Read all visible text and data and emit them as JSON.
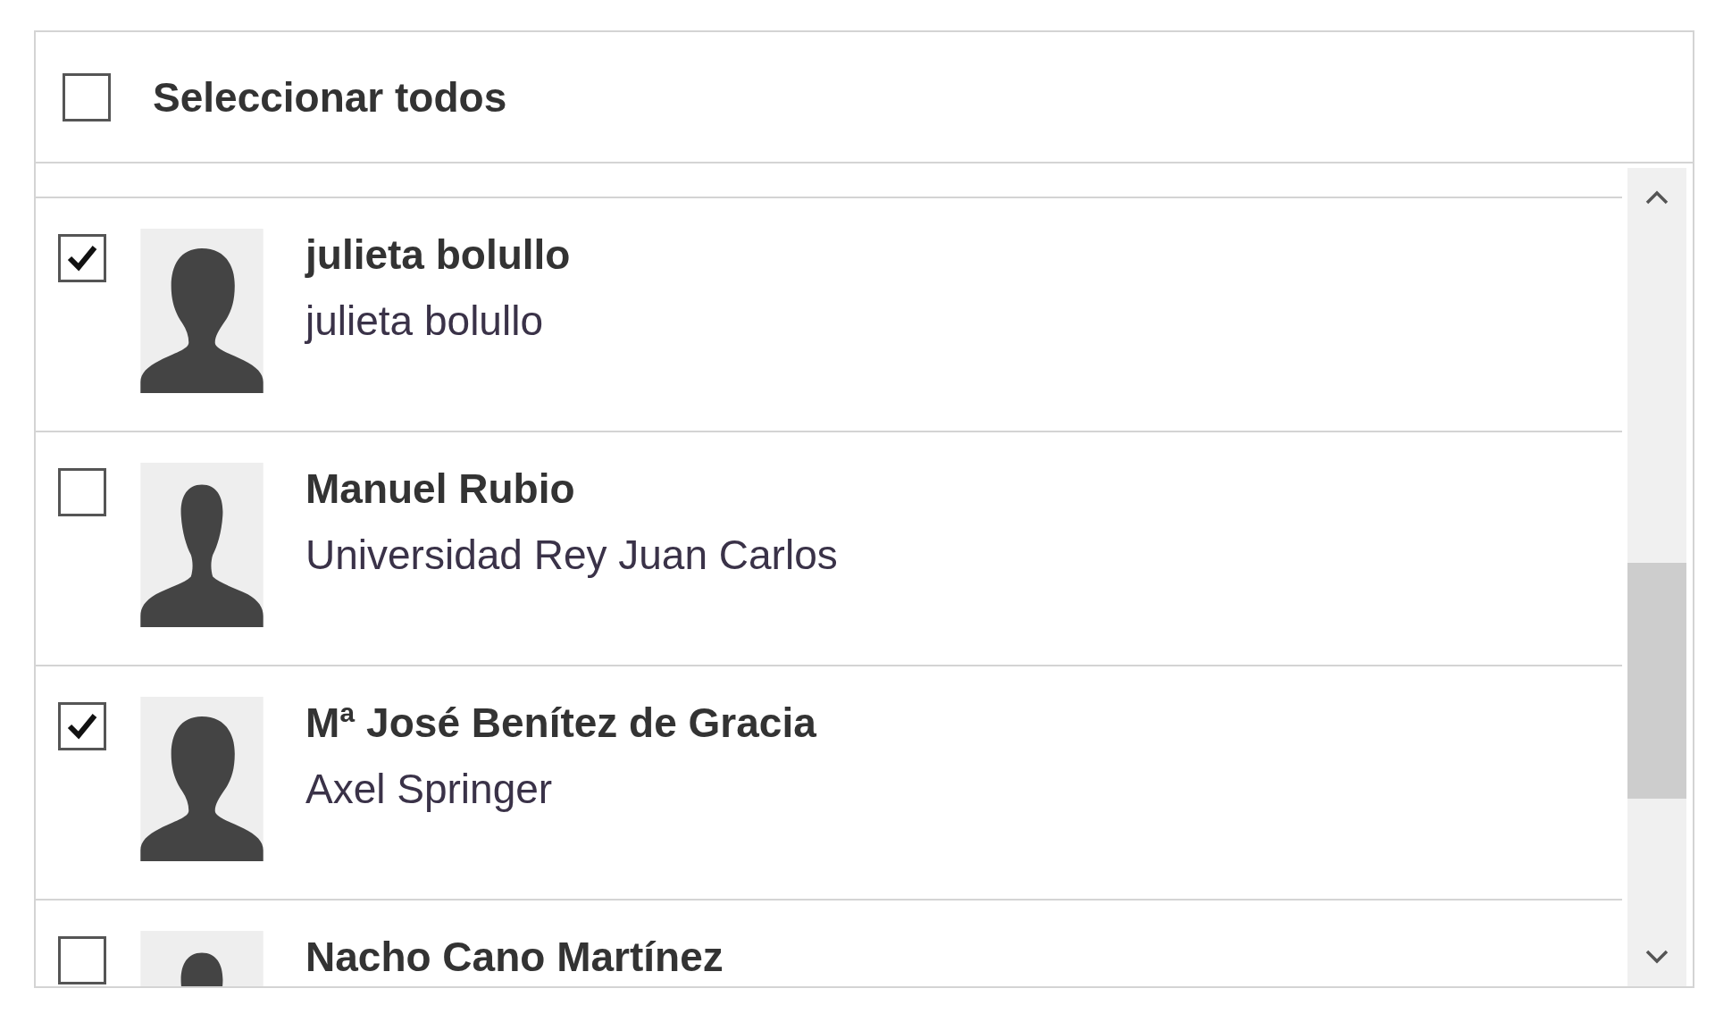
{
  "select_all": {
    "label": "Seleccionar todos",
    "checked": false
  },
  "rows": [
    {
      "name": "julieta bolullo",
      "subtitle": "julieta bolullo",
      "checked": true,
      "kind": "female"
    },
    {
      "name": "Manuel Rubio",
      "subtitle": "Universidad Rey Juan Carlos",
      "checked": false,
      "kind": "male"
    },
    {
      "name": "Mª José Benítez de Gracia",
      "subtitle": "Axel Springer",
      "checked": true,
      "kind": "female"
    },
    {
      "name": "Nacho Cano Martínez",
      "checked": false,
      "kind": "male"
    }
  ]
}
